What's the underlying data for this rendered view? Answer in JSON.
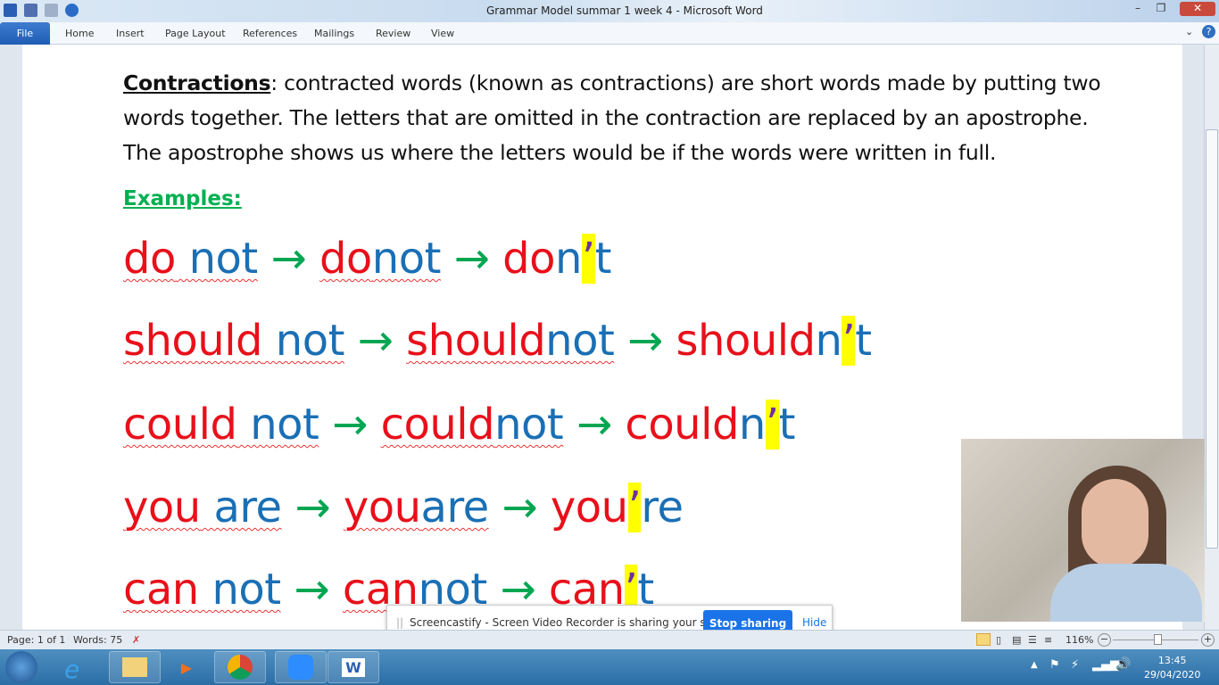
{
  "window": {
    "title": "Grammar Model summar 1 week 4  -  Microsoft Word"
  },
  "ribbon": {
    "tabs": [
      "File",
      "Home",
      "Insert",
      "Page Layout",
      "References",
      "Mailings",
      "Review",
      "View"
    ]
  },
  "document": {
    "heading": "Contractions",
    "paragraph": ": contracted words (known as contractions) are short words made by putting two words together. The letters that are omitted in the contraction are replaced by an apostrophe. The apostrophe shows us where the letters would be if the words were written in full.",
    "examples_label": "Examples:",
    "rows": [
      [
        [
          "do",
          "r"
        ],
        [
          " not",
          "b"
        ],
        [
          " → ",
          "g"
        ],
        [
          "do",
          "r"
        ],
        [
          "not",
          "b"
        ],
        [
          " → ",
          "g"
        ],
        [
          "do",
          "r"
        ],
        [
          "n",
          "b"
        ],
        [
          "’",
          "p"
        ],
        [
          "t",
          "b"
        ]
      ],
      [
        [
          "should",
          "r"
        ],
        [
          " not",
          "b"
        ],
        [
          " → ",
          "g"
        ],
        [
          "should",
          "r"
        ],
        [
          "not",
          "b"
        ],
        [
          " → ",
          "g"
        ],
        [
          "should",
          "r"
        ],
        [
          "n",
          "b"
        ],
        [
          "’",
          "p"
        ],
        [
          "t",
          "b"
        ]
      ],
      [
        [
          "could",
          "r"
        ],
        [
          " not",
          "b"
        ],
        [
          " → ",
          "g"
        ],
        [
          "could",
          "r"
        ],
        [
          "not",
          "b"
        ],
        [
          " → ",
          "g"
        ],
        [
          "could",
          "r"
        ],
        [
          "n",
          "b"
        ],
        [
          "’",
          "p"
        ],
        [
          "t",
          "b"
        ]
      ],
      [
        [
          "you",
          "r"
        ],
        [
          " are",
          "b"
        ],
        [
          " → ",
          "g"
        ],
        [
          "you",
          "r"
        ],
        [
          "are",
          "b"
        ],
        [
          " → ",
          "g"
        ],
        [
          "you",
          "r"
        ],
        [
          "’",
          "p"
        ],
        [
          "re",
          "b"
        ]
      ],
      [
        [
          "can",
          "r"
        ],
        [
          " not",
          "b"
        ],
        [
          " → ",
          "g"
        ],
        [
          "can",
          "r"
        ],
        [
          "not",
          "b"
        ],
        [
          " → ",
          "g"
        ],
        [
          "can",
          "r"
        ],
        [
          "’",
          "p"
        ],
        [
          "t",
          "b"
        ]
      ]
    ]
  },
  "status": {
    "page": "Page: 1 of 1",
    "words": "Words: 75",
    "zoom": "116%"
  },
  "share_bar": {
    "message": "Screencastify - Screen Video Recorder is sharing your screen.",
    "stop": "Stop sharing",
    "hide": "Hide"
  },
  "taskbar": {
    "time": "13:45",
    "date": "29/04/2020"
  }
}
